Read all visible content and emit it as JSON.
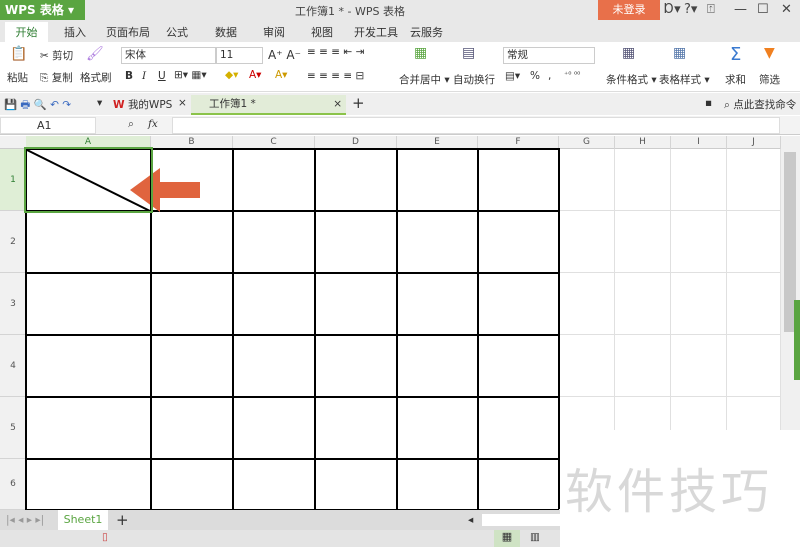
{
  "app": {
    "name": "WPS 表格",
    "title": "工作簿1 * - WPS 表格",
    "login": "未登录"
  },
  "menu_tabs": [
    "开始",
    "插入",
    "页面布局",
    "公式",
    "数据",
    "审阅",
    "视图",
    "开发工具",
    "云服务"
  ],
  "ribbon": {
    "paste": "粘贴",
    "cut": "剪切",
    "copy": "复制",
    "format_painter": "格式刷",
    "font": "宋体",
    "font_size": "11",
    "bold": "B",
    "italic": "I",
    "underline": "U",
    "merge": "合并居中",
    "wrap": "自动换行",
    "number_format": "常规",
    "percent": "%",
    "comma": ",",
    "cond_format": "条件格式",
    "table_style": "表格样式",
    "sum": "求和",
    "filter": "筛选"
  },
  "quick": {
    "my_wps": "我的WPS",
    "doc_tab": "工作簿1 *",
    "add": "+",
    "search": "点此查找命令"
  },
  "formula": {
    "cell_ref": "A1",
    "fx": "fx",
    "value": ""
  },
  "columns": [
    "A",
    "B",
    "C",
    "D",
    "E",
    "F",
    "G",
    "H",
    "I",
    "J"
  ],
  "rows": [
    "1",
    "2",
    "3",
    "4",
    "5",
    "6"
  ],
  "sheets": [
    "Sheet1"
  ],
  "watermark": "软件技巧",
  "colors": {
    "accent": "#5aa541",
    "login": "#e8704a",
    "arrow": "#e0643e"
  }
}
